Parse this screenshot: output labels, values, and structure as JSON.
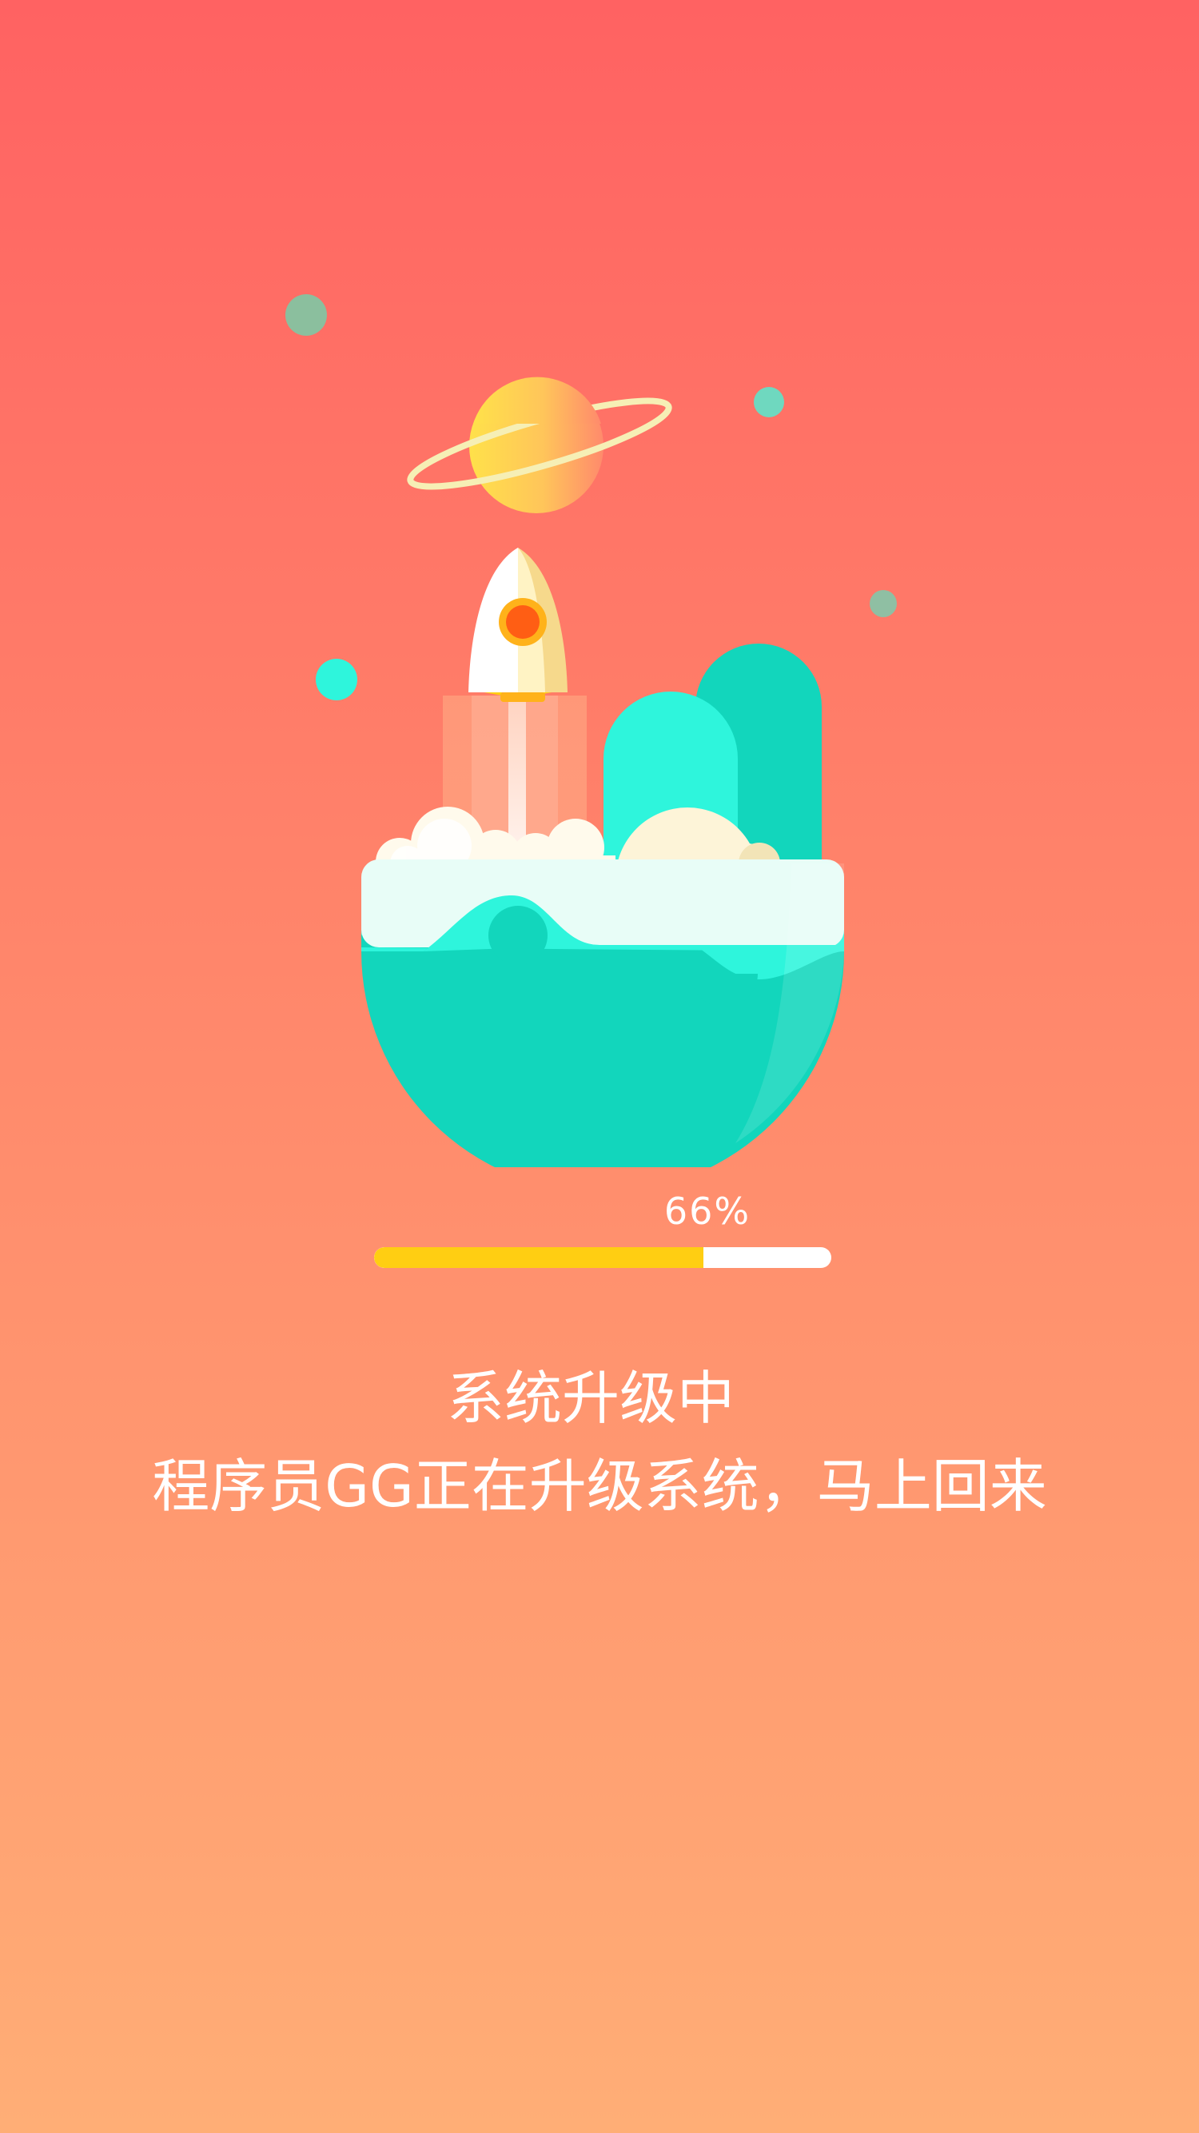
{
  "progress": {
    "percent_label": "66%",
    "value": 0.72
  },
  "status": {
    "title": "系统升级中",
    "message": "程序员GG正在升级系统，马上回来"
  },
  "colors": {
    "bg_top": "#ff6262",
    "bg_bottom": "#ffae76",
    "progress_fill": "#ffce12",
    "progress_track": "#ffffff",
    "teal": "#12d6bc",
    "aqua": "#2ef5dc"
  },
  "icons": [
    "planet-icon",
    "rocket-icon",
    "island-icon"
  ]
}
